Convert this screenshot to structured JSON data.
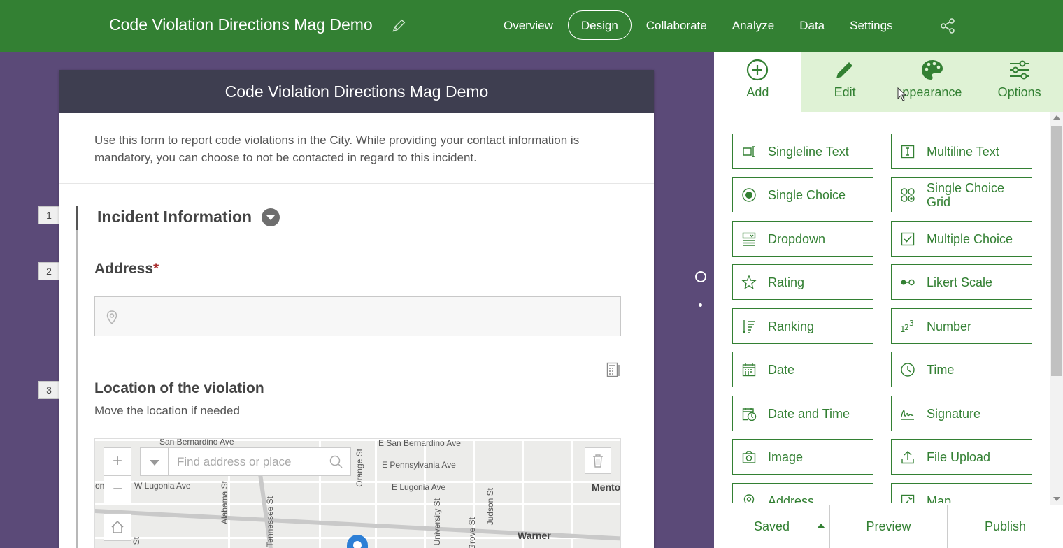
{
  "app": {
    "title": "Code Violation Directions Mag Demo",
    "nav_tabs": [
      "Overview",
      "Design",
      "Collaborate",
      "Analyze",
      "Data",
      "Settings"
    ],
    "active_tab": "Design",
    "brand_color": "#338033"
  },
  "form": {
    "header": "Code Violation Directions Mag Demo",
    "description": "Use this form to report code violations in the City. While providing your contact information is mandatory, you can choose to not be contacted in regard to this incident.",
    "section_title": "Incident Information",
    "questions": [
      {
        "number": "1"
      },
      {
        "number": "2",
        "label": "Address",
        "required_mark": "*"
      },
      {
        "number": "3",
        "label": "Location of the violation",
        "hint": "Move the location if needed"
      }
    ],
    "map": {
      "search_placeholder": "Find address or place",
      "zoom_in": "+",
      "zoom_out": "−",
      "labels": [
        "San Bernardino Ave",
        "E San Bernardino Ave",
        "E Pennsylvania Ave",
        "W Lugonia Ave",
        "E Lugonia Ave",
        "Mento",
        "Warner",
        "Alabama St",
        "Tennessee St",
        "Orange St",
        "N University St",
        "Grove St",
        "Judson St",
        "St",
        "on"
      ]
    }
  },
  "panel": {
    "tabs": [
      {
        "label": "Add",
        "icon": "plus-circle-icon"
      },
      {
        "label": "Edit",
        "icon": "pencil-icon"
      },
      {
        "label": "ppearance",
        "icon": "palette-icon"
      },
      {
        "label": "Options",
        "icon": "sliders-icon"
      }
    ],
    "question_types": [
      [
        "Singleline Text",
        "Multiline Text"
      ],
      [
        "Single Choice",
        "Single Choice Grid"
      ],
      [
        "Dropdown",
        "Multiple Choice"
      ],
      [
        "Rating",
        "Likert Scale"
      ],
      [
        "Ranking",
        "Number"
      ],
      [
        "Date",
        "Time"
      ],
      [
        "Date and Time",
        "Signature"
      ],
      [
        "Image",
        "File Upload"
      ],
      [
        "Address",
        "Map"
      ]
    ],
    "footer": {
      "saved": "Saved",
      "preview": "Preview",
      "publish": "Publish"
    }
  }
}
